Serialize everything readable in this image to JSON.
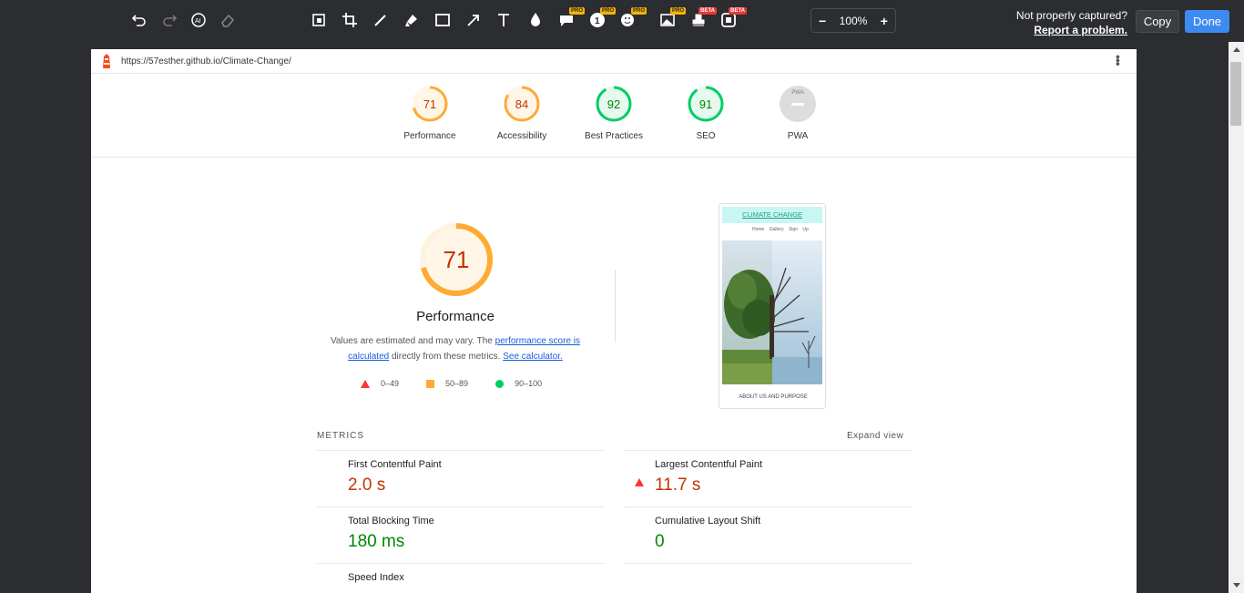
{
  "toolbar": {
    "zoom_level": "100%",
    "zoom_minus": "−",
    "zoom_plus": "+",
    "not_captured_text": "Not properly captured?",
    "report_link": "Report a problem.",
    "copy_label": "Copy",
    "done_label": "Done",
    "tags": {
      "pro": "PRO",
      "beta": "BETA"
    }
  },
  "page": {
    "url": "https://57esther.github.io/Climate-Change/",
    "gauges": [
      {
        "label": "Performance",
        "score": "71",
        "color": "#fa3"
      },
      {
        "label": "Accessibility",
        "score": "84",
        "color": "#fa3"
      },
      {
        "label": "Best Practices",
        "score": "92",
        "color": "#0c6"
      },
      {
        "label": "SEO",
        "score": "91",
        "color": "#0c6"
      },
      {
        "label": "PWA",
        "score": "",
        "badge": "PWA"
      }
    ],
    "performance": {
      "score": "71",
      "title": "Performance",
      "desc_prefix": "Values are estimated and may vary. The ",
      "desc_link1": "performance score is calculated",
      "desc_middle": " directly from these metrics. ",
      "desc_link2": "See calculator."
    },
    "legend": [
      {
        "range": "0–49"
      },
      {
        "range": "50–89"
      },
      {
        "range": "90–100"
      }
    ],
    "phone_preview": {
      "title": "CLIMATE CHANGE",
      "nav": "Home Gallery Sign Up",
      "about": "ABOUT US AND PURPOSE"
    },
    "metrics_header": "METRICS",
    "expand_view": "Expand view",
    "metrics": [
      {
        "name": "First Contentful Paint",
        "value": "2.0 s",
        "status": "average"
      },
      {
        "name": "Largest Contentful Paint",
        "value": "11.7 s",
        "status": "fail"
      },
      {
        "name": "Total Blocking Time",
        "value": "180 ms",
        "status": "pass"
      },
      {
        "name": "Cumulative Layout Shift",
        "value": "0",
        "status": "pass"
      },
      {
        "name": "Speed Index",
        "value": "",
        "status": "pass"
      }
    ]
  },
  "colors": {
    "accent_blue": "#3d8bf0",
    "fail": "#c33300",
    "pass": "#080",
    "average": "#fa3"
  }
}
